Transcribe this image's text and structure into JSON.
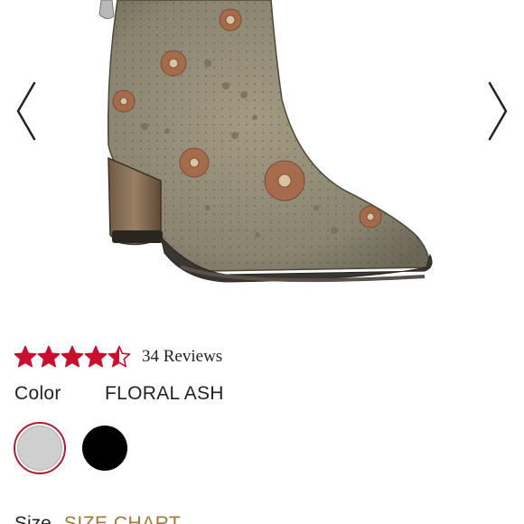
{
  "gallery": {
    "image_alt": "Floral perforated ankle boot",
    "prev_icon": "chevron-left-icon",
    "next_icon": "chevron-right-icon"
  },
  "rating": {
    "value": 4.5,
    "max": 5,
    "star_color": "#c8102e",
    "reviews_label": "34 Reviews"
  },
  "color": {
    "label": "Color",
    "value": "FLORAL ASH",
    "swatches": [
      {
        "name": "floral-ash",
        "color": "#cfcfcf",
        "selected": true
      },
      {
        "name": "black",
        "color": "#000000",
        "selected": false
      }
    ],
    "selected_ring_color": "#a81e2d"
  },
  "size": {
    "label": "Size",
    "chart_link": "SIZE CHART"
  }
}
